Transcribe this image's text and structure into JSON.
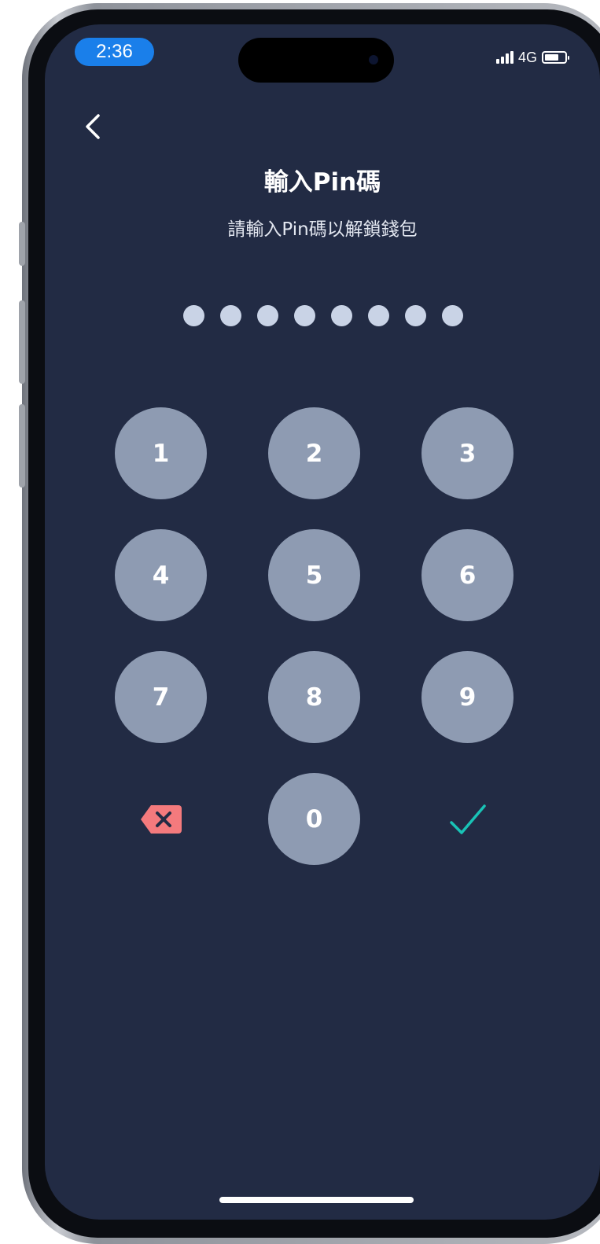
{
  "status_bar": {
    "time": "2:36",
    "network": "4G",
    "signal_icon": "cellular-signal-icon",
    "battery_icon": "battery-icon",
    "battery_level": 0.7
  },
  "header": {
    "back_icon": "chevron-left-icon",
    "title": "輸入Pin碼",
    "subtitle": "請輸入Pin碼以解鎖錢包"
  },
  "pin": {
    "entered_count": 8
  },
  "keypad": {
    "keys": [
      "1",
      "2",
      "3",
      "4",
      "5",
      "6",
      "7",
      "8",
      "9"
    ],
    "zero": "0",
    "delete_icon": "backspace-icon",
    "confirm_icon": "checkmark-icon"
  },
  "colors": {
    "background": "#222b44",
    "key": "#8e9bb2",
    "dot": "#c9d3e6",
    "delete": "#f47a7d",
    "confirm": "#19c3b6",
    "time_pill": "#1a7fea"
  }
}
